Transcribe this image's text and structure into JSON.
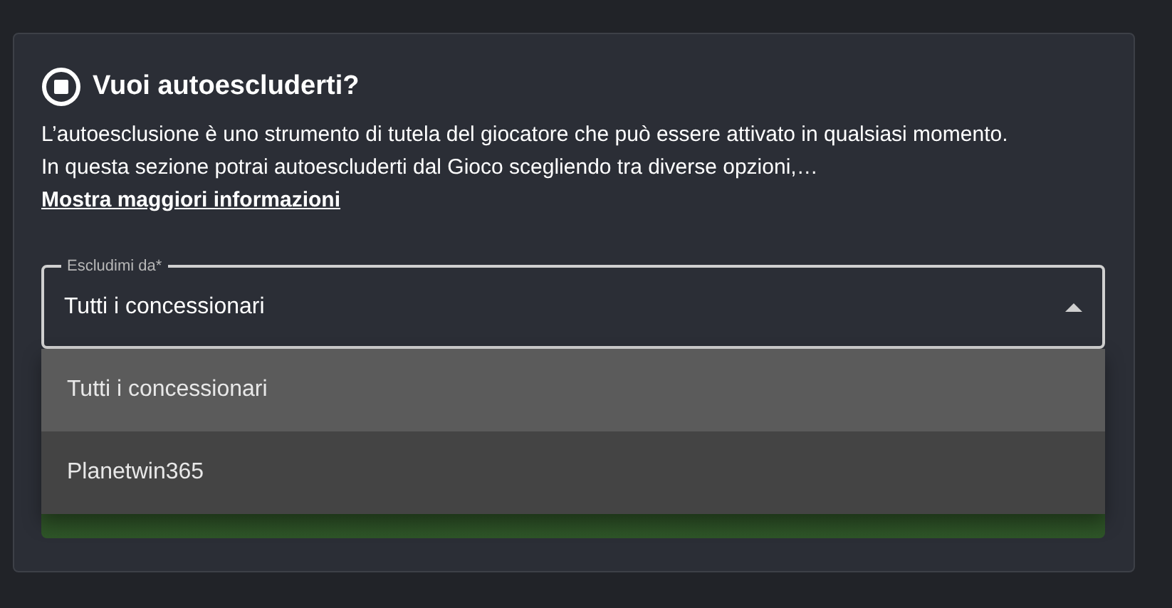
{
  "title": "Vuoi autoescluderti?",
  "description": "L’autoesclusione è uno strumento di tutela del giocatore che può essere attivato in qualsiasi momento. In questa sezione potrai autoescluderti dal Gioco scegliendo tra diverse opzioni,…",
  "more_link": "Mostra maggiori informazioni",
  "select": {
    "label": "Escludimi da*",
    "value": "Tutti i concessionari",
    "expanded": true,
    "options": [
      {
        "label": "Tutti i concessionari",
        "selected": true
      },
      {
        "label": "Planetwin365",
        "selected": false
      }
    ]
  }
}
